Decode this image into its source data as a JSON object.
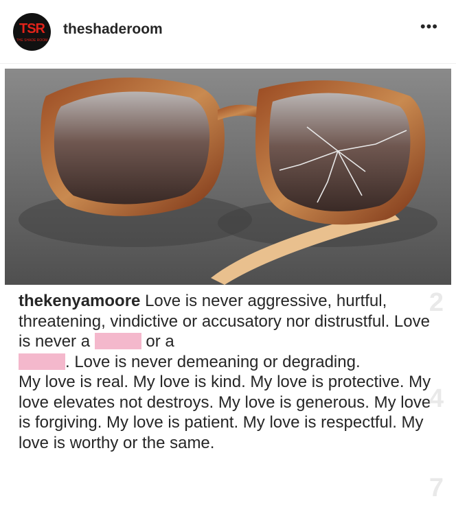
{
  "header": {
    "username": "theshaderoom",
    "avatar_text": "TSR",
    "avatar_subtext": "THE SHADE ROOM",
    "more_label": "•••"
  },
  "photo": {
    "icon": "sunglasses-photo"
  },
  "caption": {
    "username": "thekenyamoore",
    "text_1": " Love is never aggressive, hurtful, threatening, vindictive or accusatory nor distrustful. Love is never a ",
    "text_2": " or a ",
    "text_3": ". Love is never demeaning or degrading.",
    "paragraph_2": "My love is real. My love is kind. My love is protective. My love elevates not destroys. My love is generous. My love is forgiving. My love is patient. My love is respectful.  My love is worthy or the same."
  },
  "watermark": {
    "numbers": [
      "2",
      "4",
      "7"
    ]
  },
  "colors": {
    "brand_red": "#e2231a",
    "redaction_pink": "#f4b8cc"
  }
}
